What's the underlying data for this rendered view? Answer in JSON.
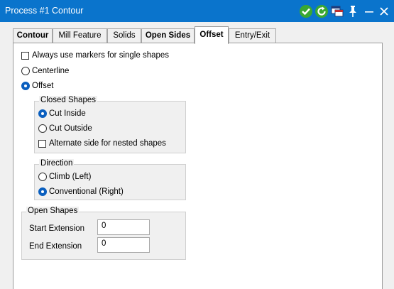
{
  "window": {
    "title": "Process #1 Contour"
  },
  "tabs": [
    {
      "label": "Contour"
    },
    {
      "label": "Mill Feature"
    },
    {
      "label": "Solids"
    },
    {
      "label": "Open Sides"
    },
    {
      "label": "Offset"
    },
    {
      "label": "Entry/Exit"
    }
  ],
  "options": {
    "always_markers": {
      "label": "Always use markers for single shapes",
      "checked": false
    },
    "mode": {
      "centerline_label": "Centerline",
      "offset_label": "Offset",
      "selected": "Offset"
    }
  },
  "closed_shapes": {
    "title": "Closed Shapes",
    "cut_inside": "Cut Inside",
    "cut_outside": "Cut Outside",
    "selected": "Cut Inside",
    "alternate": {
      "label": "Alternate side for nested shapes",
      "checked": false
    }
  },
  "direction": {
    "title": "Direction",
    "climb": "Climb (Left)",
    "conventional": "Conventional (Right)",
    "selected": "Conventional (Right)"
  },
  "open_shapes": {
    "title": "Open Shapes",
    "start_label": "Start Extension",
    "start_value": "0",
    "end_label": "End Extension",
    "end_value": "0"
  },
  "colors": {
    "titlebar": "#0a74cc",
    "accept": "#3aa832",
    "radio_selected": "#0a5fbf"
  },
  "icons": [
    "accept-icon",
    "refresh-icon",
    "window-list-icon",
    "pin-icon",
    "minimize-icon",
    "close-icon"
  ]
}
